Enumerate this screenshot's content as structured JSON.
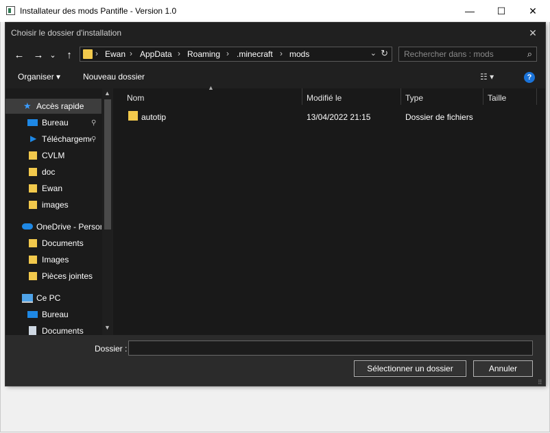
{
  "app": {
    "title": "Installateur des mods Pantifle - Version 1.0",
    "minimize": "—",
    "maximize": "☐",
    "close": "✕"
  },
  "dialog": {
    "title": "Choisir le dossier d'installation",
    "close": "✕",
    "nav": {
      "back": "←",
      "forward": "→",
      "recent": "⌄",
      "up": "↑"
    },
    "address": {
      "crumbs": [
        "Ewan",
        "AppData",
        "Roaming",
        ".minecraft",
        "mods"
      ],
      "separator": "›",
      "dropdown": "⌄",
      "refresh": "↻"
    },
    "search": {
      "placeholder": "Rechercher dans : mods",
      "icon": "⌕"
    },
    "toolbar": {
      "organize": "Organiser ▾",
      "new_folder": "Nouveau dossier",
      "view": "☷ ▾",
      "help": "?"
    },
    "sidebar": {
      "items": [
        {
          "label": "Accès rapide",
          "icon": "star-icon"
        },
        {
          "label": "Bureau",
          "icon": "desktop-icon",
          "pinned": true
        },
        {
          "label": "Téléchargements",
          "icon": "download-icon",
          "pinned": true
        },
        {
          "label": "CVLM",
          "icon": "folder-icon"
        },
        {
          "label": "doc",
          "icon": "folder-icon"
        },
        {
          "label": "Ewan",
          "icon": "folder-icon"
        },
        {
          "label": "images",
          "icon": "folder-icon"
        },
        {
          "label": "OneDrive - Personal",
          "icon": "cloud-icon"
        },
        {
          "label": "Documents",
          "icon": "folder-icon"
        },
        {
          "label": "Images",
          "icon": "folder-icon"
        },
        {
          "label": "Pièces jointes",
          "icon": "folder-icon"
        },
        {
          "label": "Ce PC",
          "icon": "pc-icon"
        },
        {
          "label": "Bureau",
          "icon": "desktop-icon"
        },
        {
          "label": "Documents",
          "icon": "document-icon"
        }
      ],
      "pin_glyph": "📌"
    },
    "columns": {
      "name": "Nom",
      "modified": "Modifié le",
      "type": "Type",
      "size": "Taille"
    },
    "rows": [
      {
        "name": "autotip",
        "modified": "13/04/2022 21:15",
        "type": "Dossier de fichiers",
        "size": ""
      }
    ],
    "footer": {
      "folder_label": "Dossier :",
      "folder_value": "",
      "select_button": "Sélectionner un dossier",
      "cancel_button": "Annuler"
    }
  },
  "colors": {
    "dialog_bg": "#202020",
    "folder": "#f2c94c",
    "accent": "#1a73d9"
  }
}
